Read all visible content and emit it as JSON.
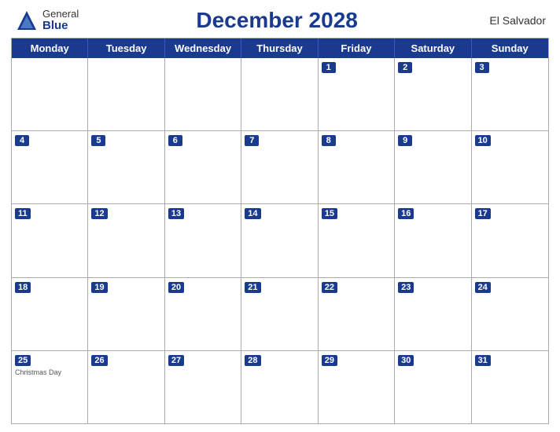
{
  "header": {
    "logo_general": "General",
    "logo_blue": "Blue",
    "title": "December 2028",
    "country": "El Salvador"
  },
  "days_of_week": [
    "Monday",
    "Tuesday",
    "Wednesday",
    "Thursday",
    "Friday",
    "Saturday",
    "Sunday"
  ],
  "weeks": [
    [
      {
        "num": "",
        "holiday": ""
      },
      {
        "num": "",
        "holiday": ""
      },
      {
        "num": "",
        "holiday": ""
      },
      {
        "num": "",
        "holiday": ""
      },
      {
        "num": "1",
        "holiday": ""
      },
      {
        "num": "2",
        "holiday": ""
      },
      {
        "num": "3",
        "holiday": ""
      }
    ],
    [
      {
        "num": "4",
        "holiday": ""
      },
      {
        "num": "5",
        "holiday": ""
      },
      {
        "num": "6",
        "holiday": ""
      },
      {
        "num": "7",
        "holiday": ""
      },
      {
        "num": "8",
        "holiday": ""
      },
      {
        "num": "9",
        "holiday": ""
      },
      {
        "num": "10",
        "holiday": ""
      }
    ],
    [
      {
        "num": "11",
        "holiday": ""
      },
      {
        "num": "12",
        "holiday": ""
      },
      {
        "num": "13",
        "holiday": ""
      },
      {
        "num": "14",
        "holiday": ""
      },
      {
        "num": "15",
        "holiday": ""
      },
      {
        "num": "16",
        "holiday": ""
      },
      {
        "num": "17",
        "holiday": ""
      }
    ],
    [
      {
        "num": "18",
        "holiday": ""
      },
      {
        "num": "19",
        "holiday": ""
      },
      {
        "num": "20",
        "holiday": ""
      },
      {
        "num": "21",
        "holiday": ""
      },
      {
        "num": "22",
        "holiday": ""
      },
      {
        "num": "23",
        "holiday": ""
      },
      {
        "num": "24",
        "holiday": ""
      }
    ],
    [
      {
        "num": "25",
        "holiday": "Christmas Day"
      },
      {
        "num": "26",
        "holiday": ""
      },
      {
        "num": "27",
        "holiday": ""
      },
      {
        "num": "28",
        "holiday": ""
      },
      {
        "num": "29",
        "holiday": ""
      },
      {
        "num": "30",
        "holiday": ""
      },
      {
        "num": "31",
        "holiday": ""
      }
    ]
  ]
}
